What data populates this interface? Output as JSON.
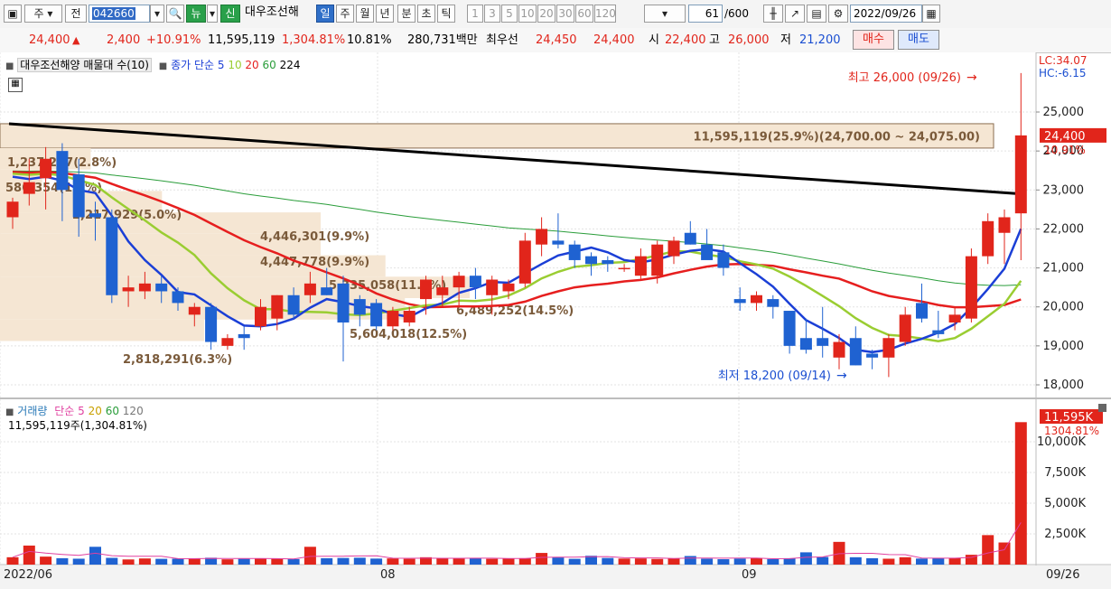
{
  "toolbar": {
    "market_label": "주",
    "type_label": "전",
    "stock_code": "042660",
    "news_label": "뉴",
    "new_label": "신",
    "stock_name": "대우조선해",
    "periods": [
      "일",
      "주",
      "월",
      "년",
      "분",
      "초",
      "틱"
    ],
    "active_period": "일",
    "interval_buttons": [
      "1",
      "3",
      "5",
      "10",
      "20",
      "30",
      "60",
      "120"
    ],
    "count_value": "61",
    "count_total": "/600",
    "date_value": "2022/09/26"
  },
  "infobar": {
    "price": "24,400",
    "change_arrow": "▲",
    "change": "2,400",
    "change_pct": "+10.91%",
    "volume": "11,595,119",
    "volume_pct": "1,304.81%",
    "turnover_pct": "10.81%",
    "trade_value": "280,731백만",
    "best_label": "최우선",
    "best_ask": "24,450",
    "best_bid": "24,400",
    "open_label": "시",
    "open": "22,400",
    "high_label": "고",
    "high": "26,000",
    "low_label": "저",
    "low": "21,200",
    "buy_button": "매수",
    "sell_button": "매도"
  },
  "price_panel": {
    "legend": {
      "stock": "대우조선해양 매물대 수(10)",
      "ma_label": "종가 단순",
      "ma_periods": [
        "5",
        "10",
        "20",
        "60",
        "224"
      ],
      "ma_colors": [
        "#1b3fd6",
        "#9acd32",
        "#e61e1e",
        "#2a9d3a",
        "#000000"
      ]
    },
    "right_labels": {
      "lc": "LC:34.07",
      "hc": "HC:-6.15"
    },
    "current_price_tag": "24,400",
    "current_pct_tag": "10.91%",
    "high_annotation": "최고 26,000 (09/26)",
    "low_annotation": "최저 18,200 (09/14)",
    "volume_profile": [
      {
        "text": "11,595,119(25.9%)(24,700.00 ~ 24,075.00)"
      },
      {
        "text": "1,237,237(2.8%)"
      },
      {
        "text": "586,354(1.3%)"
      },
      {
        "text": "2,217,929(5.0%)"
      },
      {
        "text": "4,446,301(9.9%)"
      },
      {
        "text": "4,447,778(9.9%)"
      },
      {
        "text": "5,335,058(11.9%)"
      },
      {
        "text": "6,489,252(14.5%)"
      },
      {
        "text": "5,604,018(12.5%)"
      },
      {
        "text": "2,818,291(6.3%)"
      }
    ]
  },
  "volume_panel": {
    "legend": {
      "label": "거래량",
      "ma_label": "단순",
      "ma_periods": [
        "5",
        "20",
        "60",
        "120"
      ],
      "ma_colors": [
        "#e040a0",
        "#c8a000",
        "#2a9d3a",
        "#777777"
      ]
    },
    "summary": "11,595,119주(1,304.81%)",
    "current_tag": "11,595K",
    "current_pct_tag": "1304.81%"
  },
  "x_axis": {
    "labels": [
      "2022/06",
      "08",
      "09"
    ],
    "last": "09/26"
  },
  "chart_data": {
    "type": "candlestick",
    "price_axis": {
      "ticks": [
        25000,
        24000,
        23000,
        22000,
        21000,
        20000,
        19000,
        18000
      ]
    },
    "volume_axis": {
      "ticks": [
        "10,000K",
        "7,500K",
        "5,000K",
        "2,500K"
      ]
    },
    "candles": [
      {
        "o": 22300,
        "h": 22800,
        "l": 22000,
        "c": 22700
      },
      {
        "o": 22900,
        "h": 23800,
        "l": 22600,
        "c": 23200
      },
      {
        "o": 23300,
        "h": 24100,
        "l": 22500,
        "c": 23800
      },
      {
        "o": 24000,
        "h": 24200,
        "l": 22200,
        "c": 23000
      },
      {
        "o": 23400,
        "h": 23800,
        "l": 21800,
        "c": 22300
      },
      {
        "o": 22400,
        "h": 22700,
        "l": 21700,
        "c": 22300
      },
      {
        "o": 22300,
        "h": 22500,
        "l": 20100,
        "c": 20300
      },
      {
        "o": 20400,
        "h": 20800,
        "l": 20000,
        "c": 20500
      },
      {
        "o": 20400,
        "h": 20900,
        "l": 20200,
        "c": 20600
      },
      {
        "o": 20600,
        "h": 20800,
        "l": 20100,
        "c": 20400
      },
      {
        "o": 20400,
        "h": 20500,
        "l": 19900,
        "c": 20100
      },
      {
        "o": 19800,
        "h": 20100,
        "l": 19500,
        "c": 20000
      },
      {
        "o": 20000,
        "h": 20100,
        "l": 18900,
        "c": 19100
      },
      {
        "o": 19000,
        "h": 19300,
        "l": 18900,
        "c": 19200
      },
      {
        "o": 19300,
        "h": 19500,
        "l": 18900,
        "c": 19200
      },
      {
        "o": 19500,
        "h": 20200,
        "l": 19400,
        "c": 20000
      },
      {
        "o": 19700,
        "h": 20300,
        "l": 19400,
        "c": 20300
      },
      {
        "o": 20300,
        "h": 20500,
        "l": 19700,
        "c": 19800
      },
      {
        "o": 20300,
        "h": 20900,
        "l": 20100,
        "c": 20600
      },
      {
        "o": 20500,
        "h": 21000,
        "l": 20300,
        "c": 20300
      },
      {
        "o": 20600,
        "h": 20800,
        "l": 18600,
        "c": 19600
      },
      {
        "o": 20200,
        "h": 20300,
        "l": 19500,
        "c": 19800
      },
      {
        "o": 20100,
        "h": 20200,
        "l": 19400,
        "c": 19500
      },
      {
        "o": 19500,
        "h": 20000,
        "l": 19400,
        "c": 19900
      },
      {
        "o": 19600,
        "h": 20000,
        "l": 19500,
        "c": 19900
      },
      {
        "o": 20200,
        "h": 20800,
        "l": 19800,
        "c": 20700
      },
      {
        "o": 20300,
        "h": 20800,
        "l": 20000,
        "c": 20500
      },
      {
        "o": 20500,
        "h": 20900,
        "l": 20000,
        "c": 20800
      },
      {
        "o": 20800,
        "h": 21000,
        "l": 20200,
        "c": 20500
      },
      {
        "o": 20300,
        "h": 20800,
        "l": 19800,
        "c": 20700
      },
      {
        "o": 20400,
        "h": 20700,
        "l": 20200,
        "c": 20600
      },
      {
        "o": 20600,
        "h": 21900,
        "l": 20500,
        "c": 21700
      },
      {
        "o": 21600,
        "h": 22300,
        "l": 21300,
        "c": 22000
      },
      {
        "o": 21700,
        "h": 22400,
        "l": 21500,
        "c": 21600
      },
      {
        "o": 21600,
        "h": 21700,
        "l": 21000,
        "c": 21200
      },
      {
        "o": 21300,
        "h": 21400,
        "l": 20800,
        "c": 21100
      },
      {
        "o": 21200,
        "h": 21300,
        "l": 20900,
        "c": 21100
      },
      {
        "o": 21000,
        "h": 21100,
        "l": 20900,
        "c": 21000
      },
      {
        "o": 20800,
        "h": 21500,
        "l": 20700,
        "c": 21300
      },
      {
        "o": 20800,
        "h": 21700,
        "l": 20600,
        "c": 21600
      },
      {
        "o": 21300,
        "h": 21800,
        "l": 21100,
        "c": 21700
      },
      {
        "o": 21900,
        "h": 22200,
        "l": 21600,
        "c": 21600
      },
      {
        "o": 21600,
        "h": 22000,
        "l": 21500,
        "c": 21200
      },
      {
        "o": 21400,
        "h": 21600,
        "l": 20800,
        "c": 21000
      },
      {
        "o": 20200,
        "h": 20500,
        "l": 19900,
        "c": 20100
      },
      {
        "o": 20100,
        "h": 20400,
        "l": 19900,
        "c": 20300
      },
      {
        "o": 20200,
        "h": 20300,
        "l": 19700,
        "c": 20000
      },
      {
        "o": 19900,
        "h": 19900,
        "l": 18800,
        "c": 19000
      },
      {
        "o": 19200,
        "h": 19700,
        "l": 18800,
        "c": 18900
      },
      {
        "o": 19200,
        "h": 20000,
        "l": 18700,
        "c": 19000
      },
      {
        "o": 18700,
        "h": 19300,
        "l": 18400,
        "c": 19100
      },
      {
        "o": 19200,
        "h": 19500,
        "l": 18500,
        "c": 18500
      },
      {
        "o": 18800,
        "h": 18900,
        "l": 18400,
        "c": 18700
      },
      {
        "o": 18700,
        "h": 19300,
        "l": 18200,
        "c": 19200
      },
      {
        "o": 19100,
        "h": 20000,
        "l": 19000,
        "c": 19800
      },
      {
        "o": 20100,
        "h": 20600,
        "l": 19600,
        "c": 19700
      },
      {
        "o": 19400,
        "h": 19900,
        "l": 19200,
        "c": 19300
      },
      {
        "o": 19600,
        "h": 20000,
        "l": 19400,
        "c": 19800
      },
      {
        "o": 19700,
        "h": 21500,
        "l": 19600,
        "c": 21300
      },
      {
        "o": 21300,
        "h": 22400,
        "l": 21100,
        "c": 22200
      },
      {
        "o": 21900,
        "h": 22500,
        "l": 21100,
        "c": 22300
      },
      {
        "o": 22400,
        "h": 26000,
        "l": 21200,
        "c": 24400
      }
    ],
    "volumes_k": [
      600,
      1550,
      650,
      520,
      480,
      1450,
      550,
      420,
      500,
      470,
      480,
      520,
      560,
      430,
      470,
      510,
      470,
      450,
      1450,
      520,
      540,
      560,
      490,
      500,
      470,
      600,
      520,
      480,
      530,
      470,
      480,
      520,
      950,
      580,
      470,
      720,
      540,
      490,
      500,
      460,
      520,
      700,
      480,
      440,
      490,
      520,
      450,
      520,
      1000,
      620,
      1850,
      600,
      520,
      480,
      600,
      490,
      520,
      530,
      800,
      2400,
      1800,
      11595
    ],
    "ma224": [
      24700,
      22900
    ],
    "volume_profile_ranges": [
      {
        "low": 24075,
        "high": 24700,
        "pct": 25.9
      },
      {
        "low": 23525,
        "high": 24075,
        "pct": 2.8
      },
      {
        "low": 22975,
        "high": 23525,
        "pct": 1.3
      },
      {
        "low": 22425,
        "high": 22975,
        "pct": 5.0
      },
      {
        "low": 21875,
        "high": 22425,
        "pct": 9.9
      },
      {
        "low": 21325,
        "high": 21875,
        "pct": 9.9
      },
      {
        "low": 20775,
        "high": 21325,
        "pct": 11.9
      },
      {
        "low": 20225,
        "high": 20775,
        "pct": 14.5
      },
      {
        "low": 19675,
        "high": 20225,
        "pct": 12.5
      },
      {
        "low": 19125,
        "high": 19675,
        "pct": 6.3
      }
    ]
  }
}
